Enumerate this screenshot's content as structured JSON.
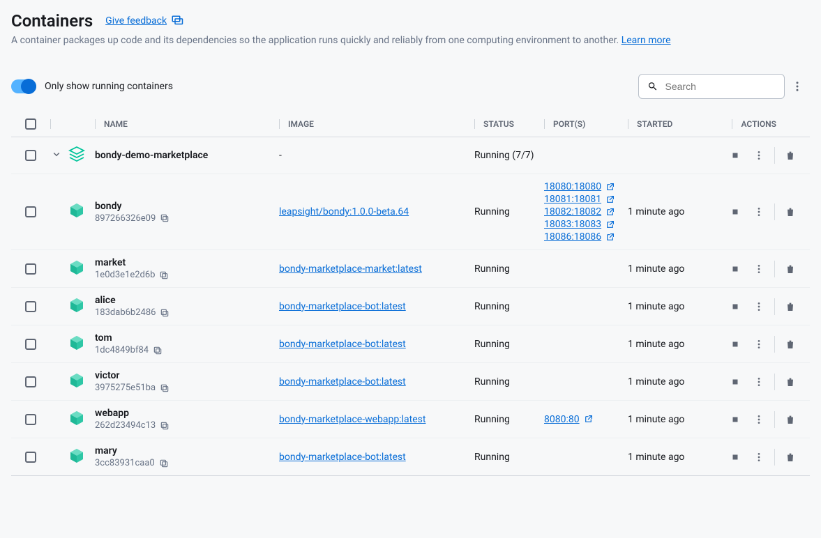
{
  "header": {
    "title": "Containers",
    "feedback_label": "Give feedback",
    "subtitle": "A container packages up code and its dependencies so the application runs quickly and reliably from one computing environment to another.",
    "learn_more": "Learn more"
  },
  "controls": {
    "toggle_label": "Only show running containers",
    "search_placeholder": "Search"
  },
  "columns": {
    "name": "NAME",
    "image": "IMAGE",
    "status": "STATUS",
    "ports": "PORT(S)",
    "started": "STARTED",
    "actions": "ACTIONS"
  },
  "rows": [
    {
      "type": "group",
      "name": "bondy-demo-marketplace",
      "image": "-",
      "status": "Running (7/7)"
    },
    {
      "type": "container",
      "name": "bondy",
      "id": "897266326e09",
      "image": "leapsight/bondy:1.0.0-beta.64",
      "status": "Running",
      "ports": [
        "18080:18080",
        "18081:18081",
        "18082:18082",
        "18083:18083",
        "18086:18086"
      ],
      "started": "1 minute ago"
    },
    {
      "type": "container",
      "name": "market",
      "id": "1e0d3e1e2d6b",
      "image": "bondy-marketplace-market:latest",
      "status": "Running",
      "ports": [],
      "started": "1 minute ago"
    },
    {
      "type": "container",
      "name": "alice",
      "id": "183dab6b2486",
      "image": "bondy-marketplace-bot:latest",
      "status": "Running",
      "ports": [],
      "started": "1 minute ago"
    },
    {
      "type": "container",
      "name": "tom",
      "id": "1dc4849bf84",
      "image": "bondy-marketplace-bot:latest",
      "status": "Running",
      "ports": [],
      "started": "1 minute ago"
    },
    {
      "type": "container",
      "name": "victor",
      "id": "3975275e51ba",
      "image": "bondy-marketplace-bot:latest",
      "status": "Running",
      "ports": [],
      "started": "1 minute ago"
    },
    {
      "type": "container",
      "name": "webapp",
      "id": "262d23494c13",
      "image": "bondy-marketplace-webapp:latest",
      "status": "Running",
      "ports": [
        "8080:80"
      ],
      "started": "1 minute ago"
    },
    {
      "type": "container",
      "name": "mary",
      "id": "3cc83931caa0",
      "image": "bondy-marketplace-bot:latest",
      "status": "Running",
      "ports": [],
      "started": "1 minute ago"
    }
  ]
}
